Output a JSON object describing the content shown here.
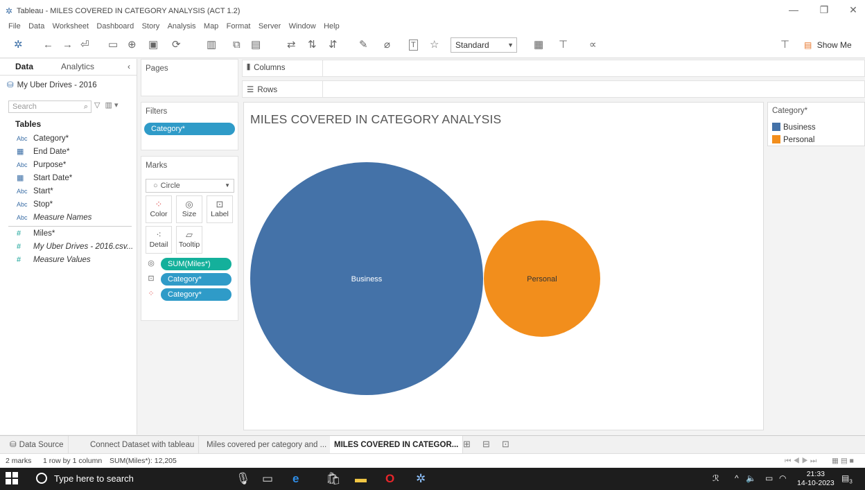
{
  "window": {
    "title": "Tableau - MILES COVERED IN CATEGORY ANALYSIS (ACT 1.2)"
  },
  "menu": [
    "File",
    "Data",
    "Worksheet",
    "Dashboard",
    "Story",
    "Analysis",
    "Map",
    "Format",
    "Server",
    "Window",
    "Help"
  ],
  "toolbar": {
    "fit_select": "Standard",
    "show_me": "Show Me"
  },
  "data_pane": {
    "tab_data": "Data",
    "tab_analytics": "Analytics",
    "datasource": "My Uber Drives - 2016",
    "search_placeholder": "Search",
    "tables_header": "Tables",
    "fields": [
      {
        "type": "Abc",
        "name": "Category*"
      },
      {
        "type": "cal",
        "name": "End Date*"
      },
      {
        "type": "Abc",
        "name": "Purpose*"
      },
      {
        "type": "cal",
        "name": "Start Date*"
      },
      {
        "type": "Abc",
        "name": "Start*"
      },
      {
        "type": "Abc",
        "name": "Stop*"
      },
      {
        "type": "Abc",
        "name": "Measure Names"
      },
      {
        "type": "#",
        "name": "Miles*"
      },
      {
        "type": "#",
        "name": "My Uber Drives - 2016.csv..."
      },
      {
        "type": "#",
        "name": "Measure Values"
      }
    ]
  },
  "cards": {
    "pages_label": "Pages",
    "filters_label": "Filters",
    "filter_pill": "Category*",
    "marks_label": "Marks",
    "mark_type": "Circle",
    "mark_buttons": [
      "Color",
      "Size",
      "Label",
      "Detail",
      "Tooltip"
    ],
    "mark_pills": [
      "SUM(Miles*)",
      "Category*",
      "Category*"
    ]
  },
  "shelves": {
    "columns": "Columns",
    "rows": "Rows"
  },
  "viz": {
    "title": "MILES COVERED IN CATEGORY ANALYSIS"
  },
  "legend": {
    "title": "Category*",
    "items": [
      {
        "label": "Business",
        "color": "#4472a8"
      },
      {
        "label": "Personal",
        "color": "#f28e1c"
      }
    ]
  },
  "chart_data": {
    "type": "packed-bubble",
    "title": "MILES COVERED IN CATEGORY ANALYSIS",
    "size_measure": "SUM(Miles*)",
    "color_dimension": "Category*",
    "bubbles": [
      {
        "category": "Business",
        "color": "#4472a8",
        "relative_size": 1.0
      },
      {
        "category": "Personal",
        "color": "#f28e1c",
        "relative_size": 0.25
      }
    ]
  },
  "sheet_tabs": {
    "data_source": "Data Source",
    "sheets": [
      "Connect Dataset with tableau",
      "Miles covered per category and ...",
      "MILES COVERED IN CATEGOR..."
    ]
  },
  "status": {
    "marks": "2 marks",
    "rows_cols": "1 row by 1 column",
    "sum": "SUM(Miles*): 12,205"
  },
  "taskbar": {
    "search": "Type here to search",
    "time": "21:33",
    "date": "14-10-2023",
    "notif_count": "3"
  }
}
